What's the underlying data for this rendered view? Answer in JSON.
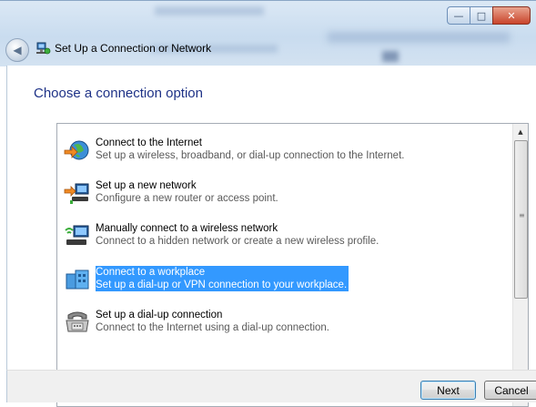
{
  "window": {
    "title": "Set Up a Connection or Network",
    "controls": {
      "minimize": "—",
      "maximize": "□",
      "close": "✕"
    },
    "back_icon": "back-arrow-icon"
  },
  "main": {
    "heading": "Choose a connection option",
    "options": [
      {
        "title": "Connect to the Internet",
        "description": "Set up a wireless, broadband, or dial-up connection to the Internet.",
        "icon": "internet-globe-icon",
        "selected": false
      },
      {
        "title": "Set up a new network",
        "description": "Configure a new router or access point.",
        "icon": "new-network-icon",
        "selected": false
      },
      {
        "title": "Manually connect to a wireless network",
        "description": "Connect to a hidden network or create a new wireless profile.",
        "icon": "wireless-network-icon",
        "selected": false
      },
      {
        "title": "Connect to a workplace",
        "description": "Set up a dial-up or VPN connection to your workplace.",
        "icon": "workplace-icon",
        "selected": true
      },
      {
        "title": "Set up a dial-up connection",
        "description": "Connect to the Internet using a dial-up connection.",
        "icon": "dialup-phone-icon",
        "selected": false
      }
    ]
  },
  "footer": {
    "next_label": "Next",
    "cancel_label": "Cancel"
  },
  "colors": {
    "heading": "#1e3287",
    "selection": "#3399ff"
  }
}
